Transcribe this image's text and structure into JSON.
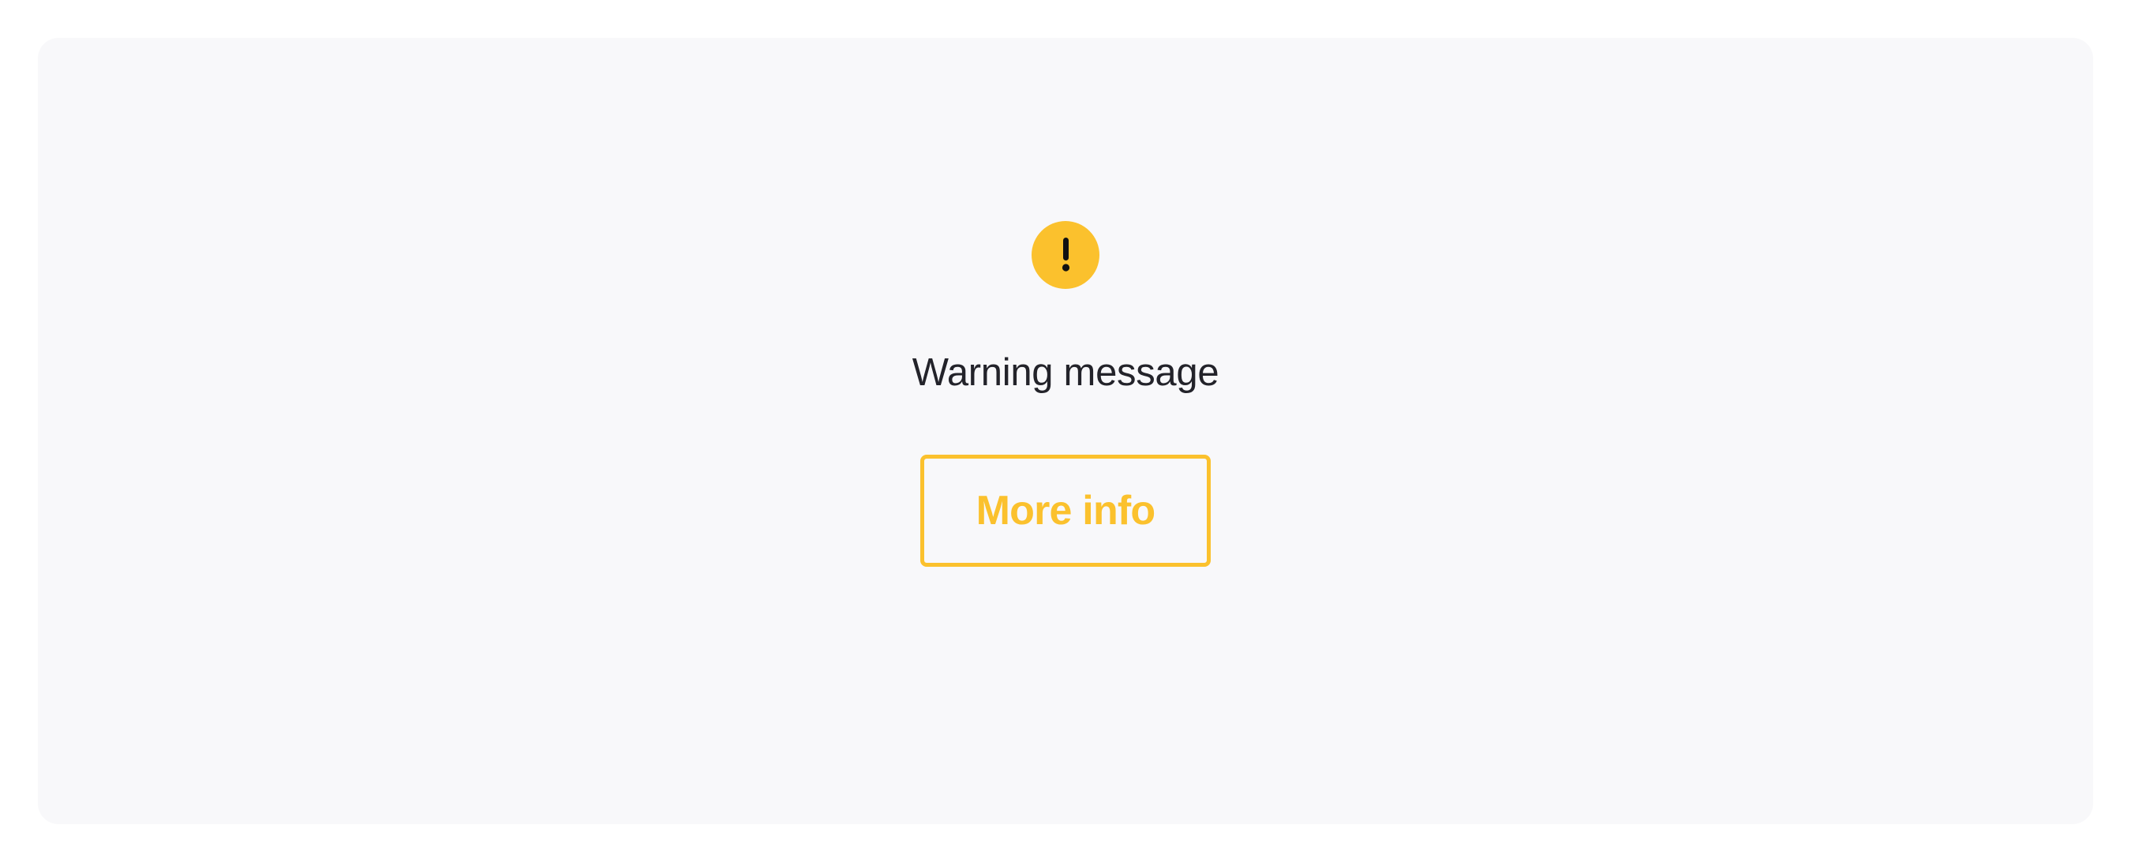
{
  "alert": {
    "icon": "exclamation-icon",
    "icon_color": "#fbc12d",
    "message": "Warning message",
    "button_label": "More info",
    "accent_color": "#fbc12d"
  }
}
